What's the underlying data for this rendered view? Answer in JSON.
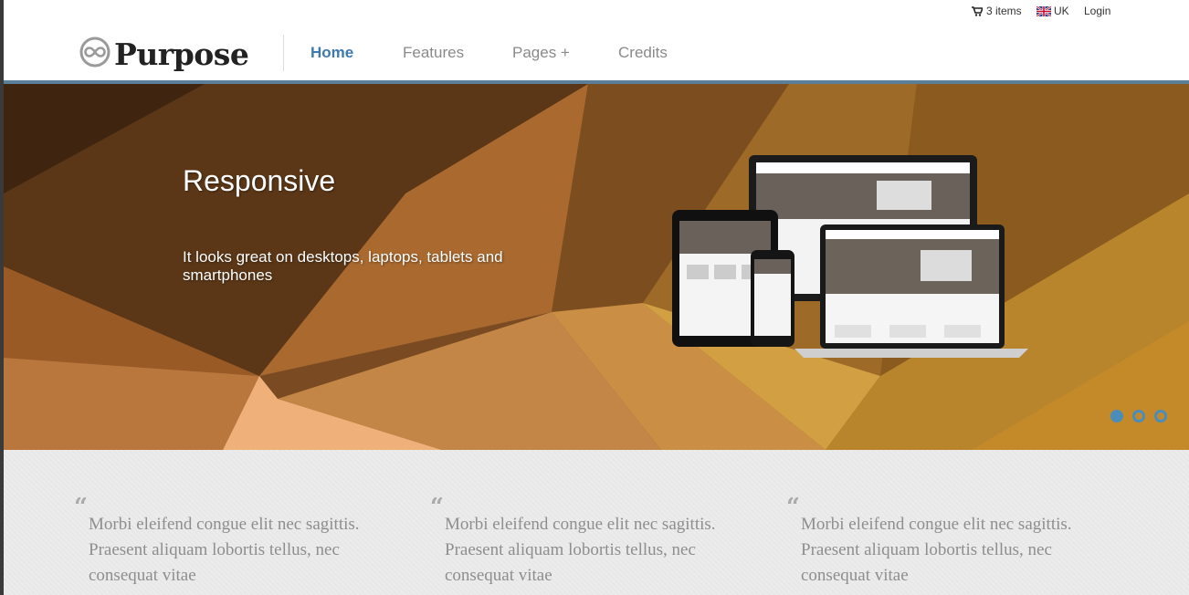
{
  "topbar": {
    "cart_label": "3 items",
    "lang_label": "UK",
    "login_label": "Login"
  },
  "brand": {
    "name": "Purpose"
  },
  "nav": {
    "items": [
      {
        "label": "Home",
        "active": true
      },
      {
        "label": "Features",
        "active": false
      },
      {
        "label": "Pages +",
        "active": false
      },
      {
        "label": "Credits",
        "active": false
      }
    ]
  },
  "hero": {
    "title": "Responsive",
    "subtitle": "It looks great on desktops, laptops, tablets and smartphones",
    "slide_count": 3,
    "active_slide": 1
  },
  "testimonials": [
    {
      "text": "Morbi eleifend congue elit nec sagittis. Praesent aliquam lobortis tellus, nec consequat vitae"
    },
    {
      "text": "Morbi eleifend congue elit nec sagittis. Praesent aliquam lobortis tellus, nec consequat vitae"
    },
    {
      "text": "Morbi eleifend congue elit nec sagittis. Praesent aliquam lobortis tellus, nec consequat vitae"
    }
  ],
  "colors": {
    "accent": "#3d7ab0",
    "header_rule": "#5b7f99",
    "slider_dot": "#4a8dbb"
  }
}
